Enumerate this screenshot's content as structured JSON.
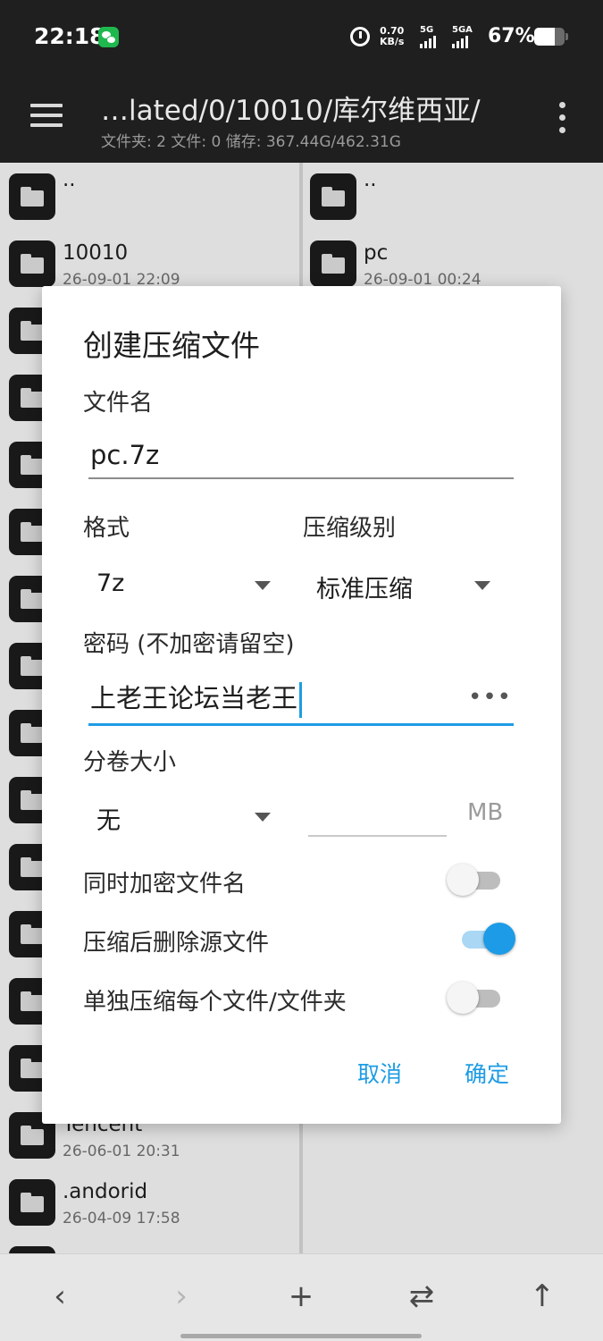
{
  "status_bar": {
    "time": "22:18",
    "network_speed_value": "0.70",
    "network_speed_unit": "KB/s",
    "sim1_tag": "5G",
    "sim2_tag": "5GA",
    "battery_percent": "67%",
    "battery_level": 0.67
  },
  "app_bar": {
    "path": "…lated/0/10010/库尔维西亚/",
    "summary": "文件夹: 2  文件: 0  储存: 367.44G/462.31G"
  },
  "left_pane": {
    "items": [
      {
        "name": "..",
        "date": ""
      },
      {
        "name": "10010",
        "date": "26-09-01 22:09"
      },
      {
        "name": "",
        "date": ""
      },
      {
        "name": "",
        "date": ""
      },
      {
        "name": "",
        "date": ""
      },
      {
        "name": "",
        "date": ""
      },
      {
        "name": "",
        "date": ""
      },
      {
        "name": "",
        "date": ""
      },
      {
        "name": "",
        "date": ""
      },
      {
        "name": "",
        "date": ""
      },
      {
        "name": "",
        "date": ""
      },
      {
        "name": "",
        "date": ""
      },
      {
        "name": "",
        "date": ""
      },
      {
        "name": "",
        "date": ""
      },
      {
        "name": "Tencent",
        "date": "26-06-01 20:31"
      },
      {
        "name": ".andorid",
        "date": "26-04-09 17:58"
      },
      {
        "name": "",
        "date": ""
      }
    ]
  },
  "right_pane": {
    "items": [
      {
        "name": "..",
        "date": ""
      },
      {
        "name": "pc",
        "date": "26-09-01 00:24"
      }
    ]
  },
  "dialog": {
    "title": "创建压缩文件",
    "filename_label": "文件名",
    "filename_value": "pc.7z",
    "format_label": "格式",
    "format_value": "7z",
    "level_label": "压缩级别",
    "level_value": "标准压缩",
    "password_label": "密码 (不加密请留空)",
    "password_value": "上老王论坛当老王",
    "password_more": "•••",
    "volume_label": "分卷大小",
    "volume_value": "无",
    "volume_unit": "MB",
    "encrypt_names_label": "同时加密文件名",
    "encrypt_names_on": false,
    "delete_source_label": "压缩后删除源文件",
    "delete_source_on": true,
    "separate_label": "单独压缩每个文件/文件夹",
    "separate_on": false,
    "cancel_label": "取消",
    "ok_label": "确定"
  },
  "bottom_bar": {
    "back_icon": "‹",
    "forward_icon": "›",
    "add_icon": "+",
    "swap_icon": "⇄",
    "up_icon": "↑"
  },
  "colors": {
    "accent": "#1f9ce4",
    "toolbar": "#1f1f1f",
    "toggle_on": "#1d9be6"
  }
}
